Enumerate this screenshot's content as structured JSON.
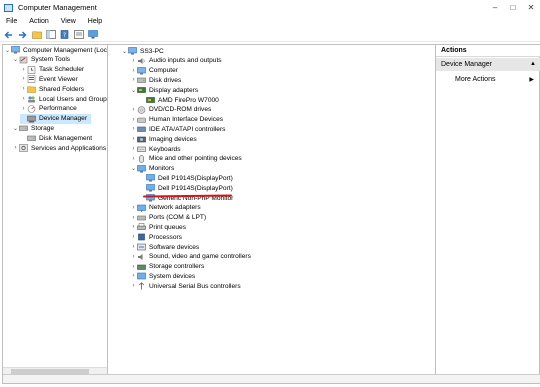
{
  "window": {
    "title": "Computer Management"
  },
  "menu": [
    "File",
    "Action",
    "View",
    "Help"
  ],
  "left_tree": [
    {
      "label": "Computer Management (Local",
      "level": 0,
      "expander": "⌄",
      "icon": "computer-management-icon"
    },
    {
      "label": "System Tools",
      "level": 1,
      "expander": "⌄",
      "icon": "tools-icon"
    },
    {
      "label": "Task Scheduler",
      "level": 2,
      "expander": "›",
      "icon": "clock-icon"
    },
    {
      "label": "Event Viewer",
      "level": 2,
      "expander": "›",
      "icon": "event-viewer-icon"
    },
    {
      "label": "Shared Folders",
      "level": 2,
      "expander": "›",
      "icon": "folder-icon"
    },
    {
      "label": "Local Users and Groups",
      "level": 2,
      "expander": "›",
      "icon": "users-icon"
    },
    {
      "label": "Performance",
      "level": 2,
      "expander": "›",
      "icon": "performance-icon"
    },
    {
      "label": "Device Manager",
      "level": 2,
      "expander": "",
      "icon": "device-manager-icon",
      "selected": true
    },
    {
      "label": "Storage",
      "level": 1,
      "expander": "⌄",
      "icon": "storage-icon"
    },
    {
      "label": "Disk Management",
      "level": 2,
      "expander": "",
      "icon": "disk-icon"
    },
    {
      "label": "Services and Applications",
      "level": 1,
      "expander": "›",
      "icon": "services-icon"
    }
  ],
  "device_tree": [
    {
      "label": "SS3-PC",
      "level": 0,
      "expander": "⌄",
      "icon": "computer-icon"
    },
    {
      "label": "Audio inputs and outputs",
      "level": 1,
      "expander": "›",
      "icon": "audio-icon"
    },
    {
      "label": "Computer",
      "level": 1,
      "expander": "›",
      "icon": "computer-icon"
    },
    {
      "label": "Disk drives",
      "level": 1,
      "expander": "›",
      "icon": "disk-icon"
    },
    {
      "label": "Display adapters",
      "level": 1,
      "expander": "⌄",
      "icon": "display-adapter-icon"
    },
    {
      "label": "AMD FirePro W7000",
      "level": 2,
      "expander": "",
      "icon": "display-adapter-icon"
    },
    {
      "label": "DVD/CD-ROM drives",
      "level": 1,
      "expander": "›",
      "icon": "dvd-icon"
    },
    {
      "label": "Human Interface Devices",
      "level": 1,
      "expander": "›",
      "icon": "hid-icon"
    },
    {
      "label": "IDE ATA/ATAPI controllers",
      "level": 1,
      "expander": "›",
      "icon": "ide-icon"
    },
    {
      "label": "Imaging devices",
      "level": 1,
      "expander": "›",
      "icon": "camera-icon"
    },
    {
      "label": "Keyboards",
      "level": 1,
      "expander": "›",
      "icon": "keyboard-icon"
    },
    {
      "label": "Mice and other pointing devices",
      "level": 1,
      "expander": "›",
      "icon": "mouse-icon"
    },
    {
      "label": "Monitors",
      "level": 1,
      "expander": "⌄",
      "icon": "monitor-icon"
    },
    {
      "label": "Dell P1914S(DisplayPort)",
      "level": 2,
      "expander": "",
      "icon": "monitor-icon"
    },
    {
      "label": "Dell P1914S(DisplayPort)",
      "level": 2,
      "expander": "",
      "icon": "monitor-icon"
    },
    {
      "label": "Generic Non-PnP Monitor",
      "level": 2,
      "expander": "",
      "icon": "monitor-icon"
    },
    {
      "label": "Network adapters",
      "level": 1,
      "expander": "›",
      "icon": "network-icon"
    },
    {
      "label": "Ports (COM & LPT)",
      "level": 1,
      "expander": "›",
      "icon": "port-icon"
    },
    {
      "label": "Print queues",
      "level": 1,
      "expander": "›",
      "icon": "printer-icon"
    },
    {
      "label": "Processors",
      "level": 1,
      "expander": "›",
      "icon": "processor-icon"
    },
    {
      "label": "Software devices",
      "level": 1,
      "expander": "›",
      "icon": "software-device-icon"
    },
    {
      "label": "Sound, video and game controllers",
      "level": 1,
      "expander": "›",
      "icon": "sound-icon"
    },
    {
      "label": "Storage controllers",
      "level": 1,
      "expander": "›",
      "icon": "storage-controller-icon"
    },
    {
      "label": "System devices",
      "level": 1,
      "expander": "›",
      "icon": "system-device-icon"
    },
    {
      "label": "Universal Serial Bus controllers",
      "level": 1,
      "expander": "›",
      "icon": "usb-icon"
    }
  ],
  "actions": {
    "header": "Actions",
    "section": "Device Manager",
    "item": "More Actions"
  },
  "colors": {
    "selection": "#cce8ff",
    "annotation_underline": "#d01818",
    "icon_blue": "#2b6fb6"
  }
}
